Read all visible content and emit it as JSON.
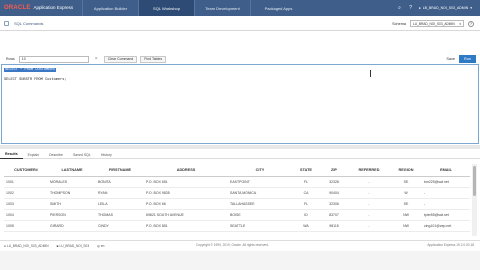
{
  "app": {
    "brand": "ORACLE",
    "product": "Application Express"
  },
  "nav_tabs": [
    {
      "label": "Application Builder"
    },
    {
      "label": "SQL Workshop"
    },
    {
      "label": "Team Development"
    },
    {
      "label": "Packaged Apps"
    }
  ],
  "header": {
    "user": "LB_BRAD_NOI_S03_ADMIN"
  },
  "breadcrumb": {
    "label": "SQL Commands"
  },
  "schema": {
    "label": "Schema",
    "value": "LU_BRAD_NOI_S03_ADMIN"
  },
  "toolbar": {
    "rows_label": "Rows",
    "rows_value": "10",
    "clear_btn": "Clear Command",
    "find_btn": "Find Tables",
    "save_btn": "Save",
    "run_btn": "Run"
  },
  "editor": {
    "line1": "SELECT * FROM CUSTOMERS",
    "line2": "SELECT SUBSTR FROM Customers;"
  },
  "result_tabs": [
    {
      "label": "Results"
    },
    {
      "label": "Explain"
    },
    {
      "label": "Describe"
    },
    {
      "label": "Saved SQL"
    },
    {
      "label": "History"
    }
  ],
  "table": {
    "columns": [
      "CUSTOMER#",
      "LASTNAME",
      "FIRSTNAME",
      "ADDRESS",
      "CITY",
      "STATE",
      "ZIP",
      "REFERRED",
      "REGION",
      "EMAIL"
    ],
    "rows": [
      [
        "1001",
        "MORALES",
        "BONITA",
        "P.O. BOX 651",
        "EASTPOINT",
        "FL",
        "32328",
        "-",
        "SE",
        "bm225@sat.net"
      ],
      [
        "1002",
        "THOMPSON",
        "RYAN",
        "P.O. BOX 9835",
        "SANTA MONICA",
        "CA",
        "90404",
        "-",
        "W",
        "-"
      ],
      [
        "1003",
        "SMITH",
        "LEILA",
        "P.O. BOX 66",
        "TALLAHASSEE",
        "FL",
        "32306",
        "-",
        "SE",
        "-"
      ],
      [
        "1004",
        "PIERSON",
        "THOMAS",
        "69821 SOUTH AVENUE",
        "BOISE",
        "ID",
        "83707",
        "-",
        "NW",
        "tpier55@sat.net"
      ],
      [
        "1005",
        "GIRARD",
        "CINDY",
        "P.O. BOX 851",
        "SEATTLE",
        "WA",
        "98115",
        "-",
        "NW",
        "cing101@zep.net"
      ]
    ]
  },
  "footer": {
    "user": "LU_BRAD_NOI_S03_ADMIN",
    "workspace": "LU_BRAD_NOI_S03",
    "language": "en",
    "copyright": "Copyright © 1999, 2019, Oracle. All rights reserved.",
    "version": "Application Express 19.2.0.00.18"
  }
}
